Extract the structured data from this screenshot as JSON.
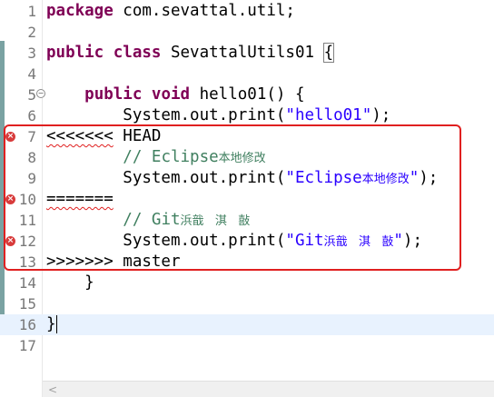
{
  "editor": {
    "lines": [
      {
        "n": "1",
        "segments": [
          [
            "kw",
            "package"
          ],
          [
            "plain",
            " com.sevattal.util;"
          ]
        ]
      },
      {
        "n": "2",
        "segments": []
      },
      {
        "n": "3",
        "segments": [
          [
            "kw",
            "public"
          ],
          [
            "plain",
            " "
          ],
          [
            "kw",
            "class"
          ],
          [
            "plain",
            " SevattalUtils01 "
          ],
          [
            "brace",
            "{"
          ]
        ]
      },
      {
        "n": "4",
        "segments": []
      },
      {
        "n": "5",
        "segments": [
          [
            "plain",
            "    "
          ],
          [
            "kw",
            "public"
          ],
          [
            "plain",
            " "
          ],
          [
            "kw",
            "void"
          ],
          [
            "plain",
            " hello01() {"
          ]
        ],
        "fold": true
      },
      {
        "n": "6",
        "segments": [
          [
            "plain",
            "        System.out.print("
          ],
          [
            "str",
            "\"hello01\""
          ],
          [
            "plain",
            ");"
          ]
        ]
      },
      {
        "n": "7",
        "segments": [
          [
            "squiggle",
            "<<<<<<<"
          ],
          [
            "plain",
            " HEAD"
          ]
        ],
        "error": true
      },
      {
        "n": "8",
        "segments": [
          [
            "plain",
            "        "
          ],
          [
            "cmt",
            "// Eclipse"
          ],
          [
            "cmtcjk",
            "本地修改"
          ]
        ]
      },
      {
        "n": "9",
        "segments": [
          [
            "plain",
            "        System.out.print("
          ],
          [
            "str",
            "\"Eclipse"
          ],
          [
            "strcjk",
            "本地修改"
          ],
          [
            "str",
            "\""
          ],
          [
            "plain",
            ");"
          ]
        ]
      },
      {
        "n": "10",
        "segments": [
          [
            "squiggle",
            "======="
          ]
        ],
        "error": true
      },
      {
        "n": "11",
        "segments": [
          [
            "plain",
            "        "
          ],
          [
            "cmt",
            "// Git"
          ],
          [
            "cmtcjk",
            "浜戠   淇   敼"
          ]
        ]
      },
      {
        "n": "12",
        "segments": [
          [
            "plain",
            "        System.out.print("
          ],
          [
            "str",
            "\"Git"
          ],
          [
            "strcjk",
            "浜戠   淇   敼"
          ],
          [
            "str",
            "\""
          ],
          [
            "plain",
            ");"
          ]
        ],
        "error": true
      },
      {
        "n": "13",
        "segments": [
          [
            "plain",
            ">>>>>>> master"
          ]
        ]
      },
      {
        "n": "14",
        "segments": [
          [
            "plain",
            "    }"
          ]
        ]
      },
      {
        "n": "15",
        "segments": []
      },
      {
        "n": "16",
        "segments": [
          [
            "plain",
            "}"
          ],
          [
            "caret",
            ""
          ]
        ],
        "current": true
      },
      {
        "n": "17",
        "segments": []
      }
    ]
  },
  "error_icon_glyph": "×",
  "fold_icon_glyph": "−",
  "scroll_left_glyph": "<",
  "colors": {
    "keyword": "#7f0055",
    "string": "#2a00ff",
    "comment": "#3f7f5f",
    "conflict_box": "#e02020",
    "change_ruler": "#7aa2a2",
    "current_line": "#e8f2fe"
  }
}
